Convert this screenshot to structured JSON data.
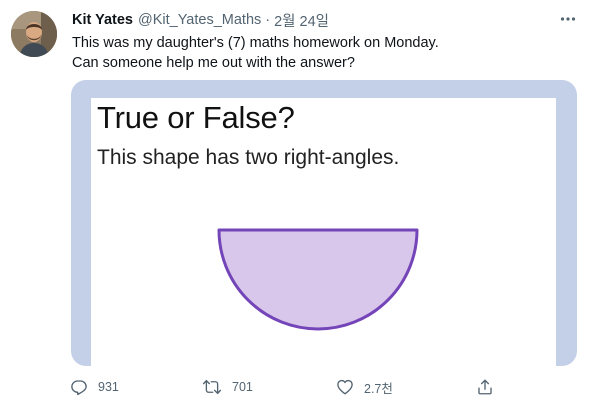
{
  "author": {
    "name": "Kit Yates",
    "handle": "@Kit_Yates_Maths",
    "separator": "·",
    "date": "2월 24일"
  },
  "tweet": {
    "line1": "This was my daughter's (7) maths homework on Monday.",
    "line2": "Can someone help me out with the answer?"
  },
  "media": {
    "title": "True or False?",
    "question": "This shape has two right-angles.",
    "shape_fill": "#d8c7ea",
    "shape_stroke": "#7445b8",
    "frame_color": "#c3d0e8"
  },
  "actions": {
    "reply_count": "931",
    "retweet_count": "701",
    "like_count": "2.7천",
    "icons": [
      "reply-icon",
      "retweet-icon",
      "like-icon",
      "share-icon"
    ]
  },
  "colors": {
    "text_primary": "#0f1419",
    "text_secondary": "#536471"
  }
}
